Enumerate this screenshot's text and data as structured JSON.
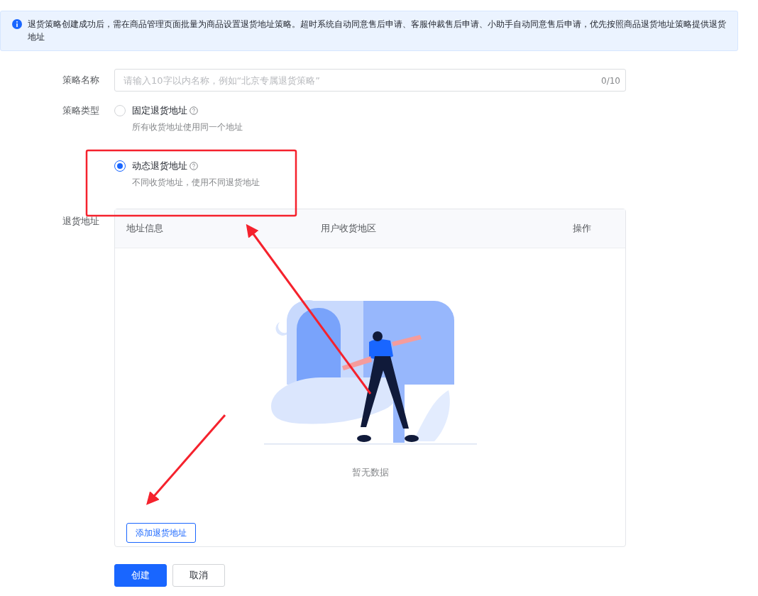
{
  "notice": {
    "text": "退货策略创建成功后，需在商品管理页面批量为商品设置退货地址策略。超时系统自动同意售后申请、客服仲裁售后申请、小助手自动同意售后申请，优先按照商品退货地址策略提供退货地址"
  },
  "form": {
    "name": {
      "label": "策略名称",
      "placeholder": "请输入10字以内名称，例如“北京专属退货策略”",
      "counter": "0/10"
    },
    "type": {
      "label": "策略类型",
      "options": [
        {
          "label": "固定退货地址",
          "hint": "所有收货地址使用同一个地址",
          "selected": false
        },
        {
          "label": "动态退货地址",
          "hint": "不同收货地址，使用不同退货地址",
          "selected": true
        }
      ]
    },
    "address": {
      "label": "退货地址",
      "table": {
        "columns": [
          "地址信息",
          "用户收货地区",
          "操作"
        ],
        "empty_text": "暂无数据"
      },
      "add_button": "添加退货地址"
    }
  },
  "buttons": [
    {
      "label": "创建",
      "kind": "primary"
    },
    {
      "label": "取消",
      "kind": "secondary"
    }
  ]
}
